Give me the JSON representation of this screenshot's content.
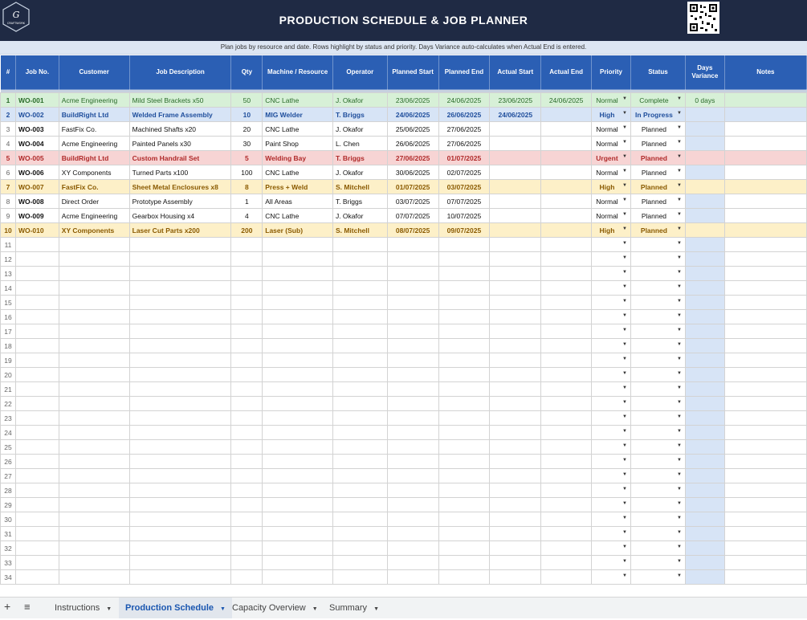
{
  "title": "PRODUCTION SCHEDULE & JOB PLANNER",
  "subtitle": "Plan jobs by resource and date. Rows highlight by status and priority. Days Variance auto-calculates when Actual End is entered.",
  "logo_text": "CRAFTWORK",
  "colors": {
    "banner": "#1f2a44",
    "header": "#2b5fb4",
    "complete": "#d7f0d7",
    "in_progress": "#d7e4f6",
    "urgent": "#f7d4d4",
    "high": "#fdf0c8"
  },
  "headers": [
    "#",
    "Job No.",
    "Customer",
    "Job Description",
    "Qty",
    "Machine / Resource",
    "Operator",
    "Planned Start",
    "Planned End",
    "Actual Start",
    "Actual End",
    "Priority",
    "Status",
    "Days Variance",
    "Notes"
  ],
  "rows": [
    {
      "n": "1",
      "job": "WO-001",
      "customer": "Acme Engineering",
      "desc": "Mild Steel Brackets x50",
      "qty": "50",
      "machine": "CNC Lathe",
      "operator": "J. Okafor",
      "ps": "23/06/2025",
      "pe": "24/06/2025",
      "as": "23/06/2025",
      "ae": "24/06/2025",
      "priority": "Normal",
      "status": "Complete",
      "days": "0 days",
      "notes": "",
      "style": "complete"
    },
    {
      "n": "2",
      "job": "WO-002",
      "customer": "BuildRight Ltd",
      "desc": "Welded Frame Assembly",
      "qty": "10",
      "machine": "MIG Welder",
      "operator": "T. Briggs",
      "ps": "24/06/2025",
      "pe": "26/06/2025",
      "as": "24/06/2025",
      "ae": "",
      "priority": "High",
      "status": "In Progress",
      "days": "",
      "notes": "",
      "style": "progress"
    },
    {
      "n": "3",
      "job": "WO-003",
      "customer": "FastFix Co.",
      "desc": "Machined Shafts x20",
      "qty": "20",
      "machine": "CNC Lathe",
      "operator": "J. Okafor",
      "ps": "25/06/2025",
      "pe": "27/06/2025",
      "as": "",
      "ae": "",
      "priority": "Normal",
      "status": "Planned",
      "days": "",
      "notes": "",
      "style": ""
    },
    {
      "n": "4",
      "job": "WO-004",
      "customer": "Acme Engineering",
      "desc": "Painted Panels x30",
      "qty": "30",
      "machine": "Paint Shop",
      "operator": "L. Chen",
      "ps": "26/06/2025",
      "pe": "27/06/2025",
      "as": "",
      "ae": "",
      "priority": "Normal",
      "status": "Planned",
      "days": "",
      "notes": "",
      "style": ""
    },
    {
      "n": "5",
      "job": "WO-005",
      "customer": "BuildRight Ltd",
      "desc": "Custom Handrail Set",
      "qty": "5",
      "machine": "Welding Bay",
      "operator": "T. Briggs",
      "ps": "27/06/2025",
      "pe": "01/07/2025",
      "as": "",
      "ae": "",
      "priority": "Urgent",
      "status": "Planned",
      "days": "",
      "notes": "",
      "style": "urgent"
    },
    {
      "n": "6",
      "job": "WO-006",
      "customer": "XY Components",
      "desc": "Turned Parts x100",
      "qty": "100",
      "machine": "CNC Lathe",
      "operator": "J. Okafor",
      "ps": "30/06/2025",
      "pe": "02/07/2025",
      "as": "",
      "ae": "",
      "priority": "Normal",
      "status": "Planned",
      "days": "",
      "notes": "",
      "style": ""
    },
    {
      "n": "7",
      "job": "WO-007",
      "customer": "FastFix Co.",
      "desc": "Sheet Metal Enclosures x8",
      "qty": "8",
      "machine": "Press + Weld",
      "operator": "S. Mitchell",
      "ps": "01/07/2025",
      "pe": "03/07/2025",
      "as": "",
      "ae": "",
      "priority": "High",
      "status": "Planned",
      "days": "",
      "notes": "",
      "style": "high"
    },
    {
      "n": "8",
      "job": "WO-008",
      "customer": "Direct Order",
      "desc": "Prototype Assembly",
      "qty": "1",
      "machine": "All Areas",
      "operator": "T. Briggs",
      "ps": "03/07/2025",
      "pe": "07/07/2025",
      "as": "",
      "ae": "",
      "priority": "Normal",
      "status": "Planned",
      "days": "",
      "notes": "",
      "style": ""
    },
    {
      "n": "9",
      "job": "WO-009",
      "customer": "Acme Engineering",
      "desc": "Gearbox Housing x4",
      "qty": "4",
      "machine": "CNC Lathe",
      "operator": "J. Okafor",
      "ps": "07/07/2025",
      "pe": "10/07/2025",
      "as": "",
      "ae": "",
      "priority": "Normal",
      "status": "Planned",
      "days": "",
      "notes": "",
      "style": ""
    },
    {
      "n": "10",
      "job": "WO-010",
      "customer": "XY Components",
      "desc": "Laser Cut Parts x200",
      "qty": "200",
      "machine": "Laser (Sub)",
      "operator": "S. Mitchell",
      "ps": "08/07/2025",
      "pe": "09/07/2025",
      "as": "",
      "ae": "",
      "priority": "High",
      "status": "Planned",
      "days": "",
      "notes": "",
      "style": "high"
    }
  ],
  "empty_row_numbers": [
    "11",
    "12",
    "13",
    "14",
    "15",
    "16",
    "17",
    "18",
    "19",
    "20",
    "21",
    "22",
    "23",
    "24",
    "25",
    "26",
    "27",
    "28",
    "29",
    "30",
    "31",
    "32",
    "33",
    "34"
  ],
  "tabs": [
    {
      "label": "Instructions",
      "active": false
    },
    {
      "label": "Production Schedule",
      "active": true
    },
    {
      "label": "Capacity Overview",
      "active": false
    },
    {
      "label": "Summary",
      "active": false
    }
  ],
  "icons": {
    "add_sheet": "plus-icon",
    "all_sheets": "menu-icon",
    "dropdown": "caret-down-icon"
  }
}
